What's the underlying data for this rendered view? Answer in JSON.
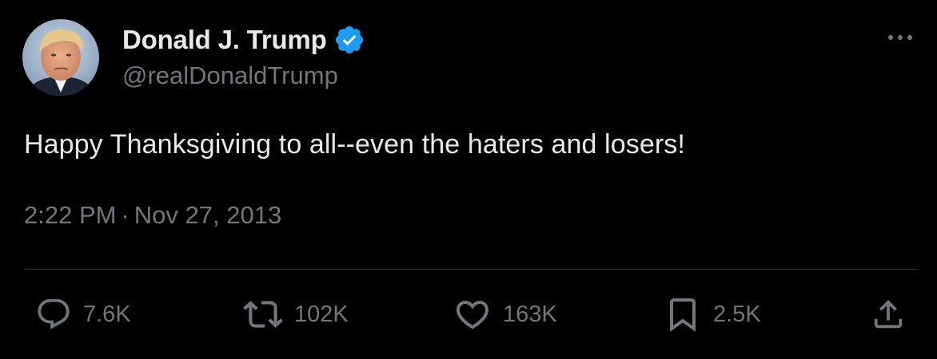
{
  "author": {
    "display_name": "Donald J. Trump",
    "handle": "@realDonaldTrump",
    "verified": true,
    "verified_color": "#1d9bf0"
  },
  "tweet": {
    "text": "Happy Thanksgiving to all--even the haters and losers!",
    "time": "2:22 PM",
    "separator": "·",
    "date": "Nov 27, 2013"
  },
  "actions": {
    "reply_count": "7.6K",
    "retweet_count": "102K",
    "like_count": "163K",
    "bookmark_count": "2.5K"
  },
  "icons": {
    "reply": "reply-icon",
    "retweet": "retweet-icon",
    "like": "heart-icon",
    "bookmark": "bookmark-icon",
    "share": "share-icon",
    "more": "more-dots-icon"
  },
  "colors": {
    "background": "#000000",
    "primary_text": "#e7e9ea",
    "secondary_text": "#71767b",
    "divider": "#2f3336"
  }
}
